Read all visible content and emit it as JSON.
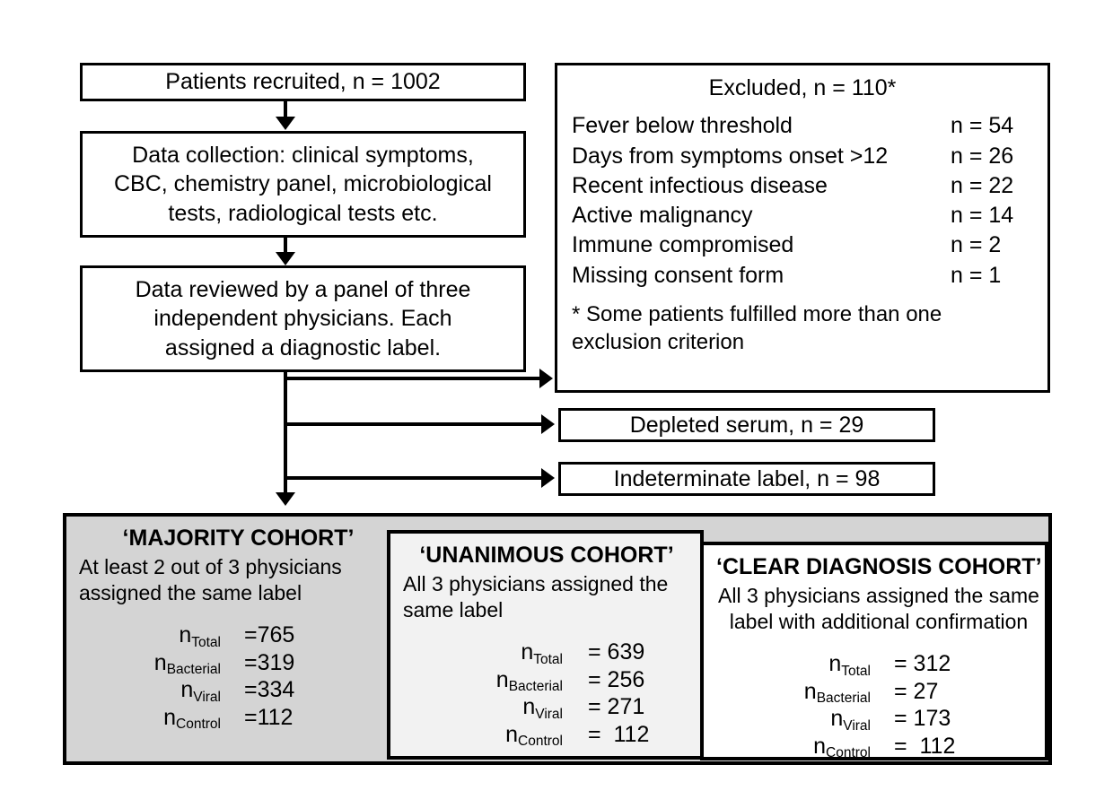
{
  "flow": {
    "step1": "Patients recruited, n = 1002",
    "step2": "Data collection: clinical symptoms,\nCBC, chemistry panel, microbiological\ntests, radiological tests etc.",
    "step3": "Data reviewed by a panel of three\nindependent physicians. Each\nassigned a diagnostic label."
  },
  "excluded": {
    "title": "Excluded, n = 110*",
    "rows": [
      {
        "label": "Fever below threshold",
        "count": "n = 54"
      },
      {
        "label": "Days from symptoms onset >12",
        "count": "n = 26"
      },
      {
        "label": "Recent infectious disease",
        "count": "n = 22"
      },
      {
        "label": "Active malignancy",
        "count": "n = 14"
      },
      {
        "label": "Immune compromised",
        "count": "n = 2"
      },
      {
        "label": "Missing  consent form",
        "count": "n = 1"
      }
    ],
    "note": "* Some patients fulfilled more than one\nexclusion criterion"
  },
  "branches": {
    "depleted_serum": "Depleted serum, n = 29",
    "indeterminate": "Indeterminate label, n = 98"
  },
  "cohorts": [
    {
      "title": "‘MAJORITY COHORT’",
      "description": "At least 2 out of 3 physicians\nassigned the same label",
      "stats": [
        {
          "key": "Total",
          "value": "=765"
        },
        {
          "key": "Bacterial",
          "value": "=319"
        },
        {
          "key": "Viral",
          "value": "=334"
        },
        {
          "key": "Control",
          "value": "=112"
        }
      ]
    },
    {
      "title": "‘UNANIMOUS COHORT’",
      "description": "All 3 physicians assigned the\nsame label",
      "stats": [
        {
          "key": "Total",
          "value": "= 639"
        },
        {
          "key": "Bacterial",
          "value": "= 256"
        },
        {
          "key": "Viral",
          "value": "= 271"
        },
        {
          "key": "Control",
          "value": "=  112"
        }
      ]
    },
    {
      "title": "‘CLEAR DIAGNOSIS COHORT’",
      "description": "All 3 physicians assigned the same\nlabel with additional confirmation",
      "stats": [
        {
          "key": "Total",
          "value": "= 312"
        },
        {
          "key": "Bacterial",
          "value": "= 27"
        },
        {
          "key": "Viral",
          "value": "= 173"
        },
        {
          "key": "Control",
          "value": "=  112"
        }
      ]
    }
  ],
  "stat_symbol": "n",
  "colors": {
    "line": "#000000",
    "majority_fill": "#d4d4d4",
    "unanimous_fill": "#f2f2f2",
    "clear_fill": "#ffffff"
  }
}
